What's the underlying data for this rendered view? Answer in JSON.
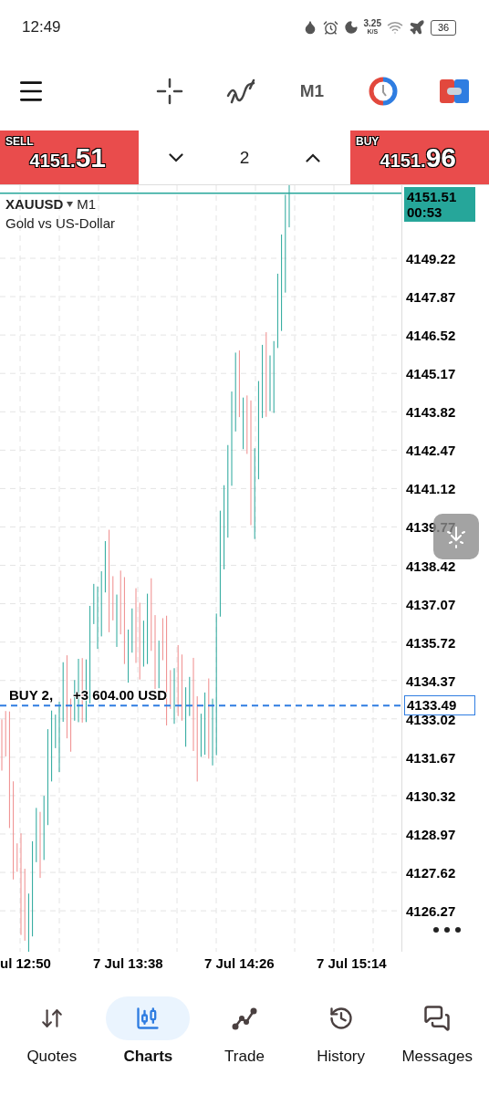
{
  "status_bar": {
    "time": "12:49",
    "net_speed": "3.25",
    "net_unit": "K/S",
    "battery": "36"
  },
  "toolbar": {
    "timeframe": "M1"
  },
  "trade_bar": {
    "sell": {
      "label": "SELL",
      "price_main": "4151.",
      "price_big": "51"
    },
    "volume": "2",
    "buy": {
      "label": "BUY",
      "price_main": "4151.",
      "price_big": "96"
    }
  },
  "chart": {
    "symbol": "XAUUSD",
    "timeframe": "M1",
    "description": "Gold vs US-Dollar",
    "current_price": "4151.51",
    "countdown": "00:53",
    "position": {
      "label": "BUY 2,",
      "profit": "+3 604.00 USD",
      "price": "4133.49"
    },
    "price_labels": [
      "4149.22",
      "4147.87",
      "4146.52",
      "4145.17",
      "4143.82",
      "4142.47",
      "4141.12",
      "4139.77",
      "4138.42",
      "4137.07",
      "4135.72",
      "4134.37",
      "4133.02",
      "4131.67",
      "4130.32",
      "4128.97",
      "4127.62",
      "4126.27"
    ],
    "time_labels": [
      "ul 12:50",
      "7 Jul 13:38",
      "7 Jul 14:26",
      "7 Jul 15:14"
    ]
  },
  "nav": [
    {
      "label": "Quotes",
      "selected": false
    },
    {
      "label": "Charts",
      "selected": true
    },
    {
      "label": "Trade",
      "selected": false
    },
    {
      "label": "History",
      "selected": false
    },
    {
      "label": "Messages",
      "selected": false
    }
  ]
}
